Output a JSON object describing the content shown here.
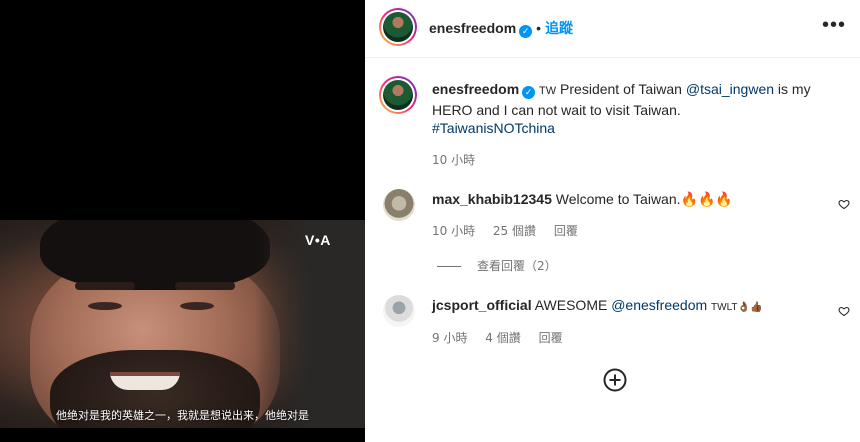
{
  "video": {
    "watermark": "V•A",
    "subtitle": "他绝对是我的英雄之一，我就是想说出来，他绝对是"
  },
  "header": {
    "username": "enesfreedom",
    "separator": "•",
    "follow_label": "追蹤",
    "more_label": "•••"
  },
  "post": {
    "username": "enesfreedom",
    "caption_prefix": "TW",
    "caption_part1": "President of Taiwan",
    "mention": "@tsai_ingwen",
    "caption_part2": "is my HERO and I can not wait to visit Taiwan.",
    "hashtag": "#TaiwanisNOTchina",
    "time": "10 小時"
  },
  "comments": [
    {
      "username": "max_khabib12345",
      "text": "Welcome to Taiwan.🔥🔥🔥",
      "time": "10 小時",
      "likes": "25 個讚",
      "reply_label": "回覆"
    },
    {
      "username": "jcsport_official",
      "text_prefix": "AWESOME",
      "mention": "@enesfreedom",
      "tag": "TWLT👌🏾👍🏾",
      "time": "9 小時",
      "likes": "4 個讚",
      "reply_label": "回覆"
    }
  ],
  "view_replies_label": "查看回覆（2）",
  "colors": {
    "link_blue": "#0095f6",
    "mention_navy": "#00376b",
    "meta_gray": "#737373"
  },
  "icons": [
    "verified-badge-icon",
    "more-options-icon",
    "heart-icon",
    "add-circle-icon"
  ]
}
